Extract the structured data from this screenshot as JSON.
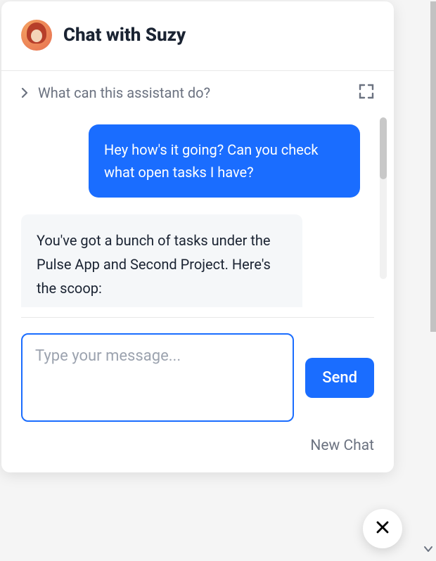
{
  "header": {
    "title": "Chat with Suzy"
  },
  "subheader": {
    "prompt": "What can this assistant do?"
  },
  "messages": {
    "user1": "Hey how's it going? Can you check what open tasks I have?",
    "assistant1": "You've got a bunch of tasks under the Pulse App and Second Project. Here's the scoop:"
  },
  "composer": {
    "placeholder": "Type your message...",
    "send_label": "Send",
    "new_chat_label": "New Chat"
  }
}
